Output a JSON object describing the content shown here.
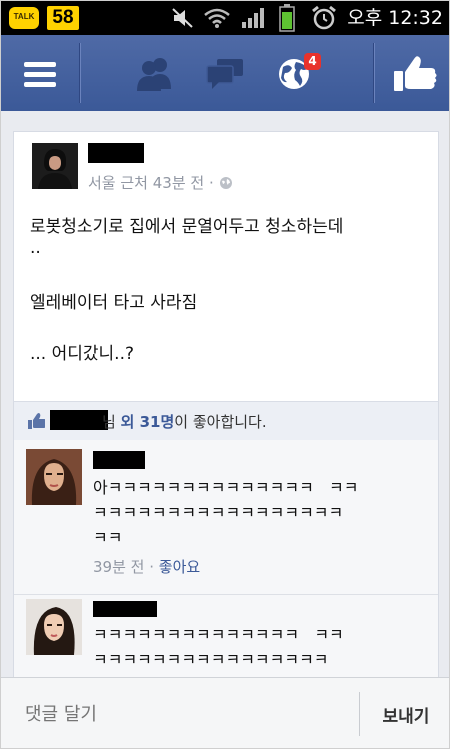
{
  "status_bar": {
    "talk_label": "TALK",
    "notification_count": "58",
    "time": "오후 12:32",
    "icons": [
      "mute-icon",
      "wifi-icon",
      "signal-icon",
      "battery-icon",
      "alarm-icon"
    ]
  },
  "nav_bar": {
    "icons": [
      "menu-icon",
      "friend-requests-icon",
      "messages-icon",
      "notifications-globe-icon",
      "like-thumb-icon"
    ],
    "notifications_badge": "4",
    "colors": {
      "bar": "#3b5998",
      "badge": "#e8322b"
    }
  },
  "post": {
    "meta": "서울 근처 43분 전 · ",
    "text_lines": [
      "로봇청소기로 집에서 문열어두고 청소하는데",
      "..",
      "엘레베이터 타고 사라짐",
      "... 어디갔니..?"
    ]
  },
  "likes": {
    "suffix": "님 ",
    "others": "외 31명",
    "tail": "이 좋아합니다."
  },
  "comments": [
    {
      "text": "아ㅋㅋㅋㅋㅋㅋㅋㅋㅋㅋㅋㅋㅋㅋ   ㅋㅋ\nㅋㅋㅋㅋㅋㅋㅋㅋㅋㅋㅋㅋㅋㅋㅋㅋㅋ\nㅋㅋ",
      "time": "39분 전",
      "dot": " · ",
      "like": "좋아요"
    },
    {
      "text": "ㅋㅋㅋㅋㅋㅋㅋㅋㅋㅋㅋㅋㅋㅋ   ㅋㅋ\nㅋㅋㅋㅋㅋㅋㅋㅋㅋㅋㅋㅋㅋㅋㅋㅋ"
    }
  ],
  "compose": {
    "placeholder": "댓글 달기",
    "send_label": "보내기"
  }
}
